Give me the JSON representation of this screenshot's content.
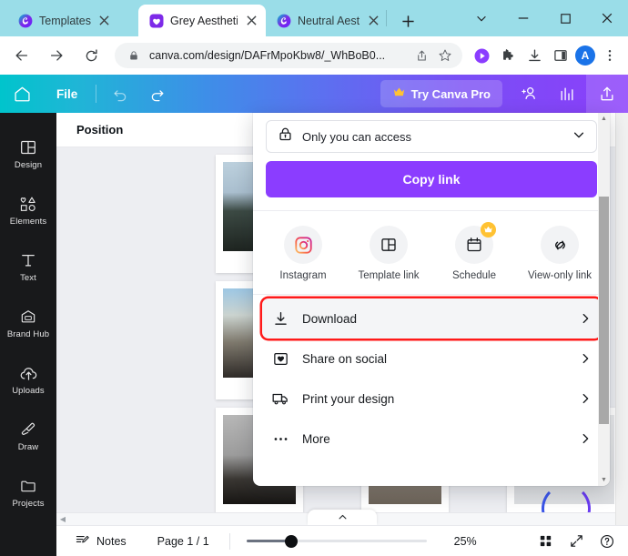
{
  "browser": {
    "tabs": [
      {
        "title": "Templates",
        "favicon": "canva-icon",
        "active": false
      },
      {
        "title": "Grey Aesthetic",
        "favicon": "canva-heart-icon",
        "active": true
      },
      {
        "title": "Neutral Aesthe",
        "favicon": "canva-icon",
        "active": false
      }
    ],
    "new_tab_label": "+",
    "url": "canva.com/design/DAFrMpoKbw8/_WhBoB0...",
    "window_controls": [
      "chevron-down-icon",
      "minimize-icon",
      "maximize-icon",
      "close-icon"
    ],
    "nav_icons": [
      "back-icon",
      "forward-icon",
      "reload-icon"
    ],
    "omnibox_icons": [
      "lock-icon",
      "share-icon",
      "bookmark-star-icon"
    ],
    "extension_icons": [
      "media-play-icon",
      "extensions-puzzle-icon",
      "downloads-icon",
      "side-panel-icon"
    ],
    "profile_initial": "A",
    "menu_icon": "kebab-menu-icon"
  },
  "canva_header": {
    "home_icon": "home-icon",
    "file_label": "File",
    "undo_icon": "undo-icon",
    "redo_icon": "redo-icon",
    "pro_label": "Try Canva Pro",
    "pro_icon": "crown-icon",
    "share_people_icon": "add-person-icon",
    "analytics_icon": "bar-chart-icon",
    "upload_icon": "share-upload-icon"
  },
  "sidebar": {
    "items": [
      {
        "label": "Design",
        "icon": "layout-design-icon"
      },
      {
        "label": "Elements",
        "icon": "shapes-elements-icon"
      },
      {
        "label": "Text",
        "icon": "text-t-icon"
      },
      {
        "label": "Brand Hub",
        "icon": "brand-hub-icon"
      },
      {
        "label": "Uploads",
        "icon": "upload-cloud-icon"
      },
      {
        "label": "Draw",
        "icon": "pen-draw-icon"
      },
      {
        "label": "Projects",
        "icon": "folder-projects-icon"
      }
    ]
  },
  "editor": {
    "position_label": "Position"
  },
  "share_panel": {
    "access": {
      "label": "Only you can access",
      "lock_icon": "lock-icon",
      "chevron_icon": "chevron-down-icon"
    },
    "copy_link_label": "Copy link",
    "copy_link_color": "#8b3dff",
    "quick_actions": [
      {
        "label": "Instagram",
        "icon": "instagram-icon",
        "badge": null
      },
      {
        "label": "Template link",
        "icon": "template-link-icon",
        "badge": null
      },
      {
        "label": "Schedule",
        "icon": "calendar-schedule-icon",
        "badge": "crown-icon"
      },
      {
        "label": "View-only link",
        "icon": "view-only-link-icon",
        "badge": null
      }
    ],
    "menu_items": [
      {
        "label": "Download",
        "icon": "download-icon",
        "chevron": "chevron-right-icon",
        "highlighted": true
      },
      {
        "label": "Share on social",
        "icon": "share-social-icon",
        "chevron": "chevron-right-icon",
        "highlighted": false
      },
      {
        "label": "Print your design",
        "icon": "truck-print-icon",
        "chevron": "chevron-right-icon",
        "highlighted": false
      },
      {
        "label": "More",
        "icon": "ellipsis-more-icon",
        "chevron": "chevron-right-icon",
        "highlighted": false
      }
    ],
    "highlight_color": "#ff1a1a"
  },
  "bottom_bar": {
    "notes_label": "Notes",
    "notes_icon": "notes-icon",
    "page_label": "Page 1 / 1",
    "zoom_level": "25%",
    "grid_icon": "grid-view-icon",
    "fullscreen_icon": "expand-fullscreen-icon",
    "help_icon": "help-question-icon"
  }
}
